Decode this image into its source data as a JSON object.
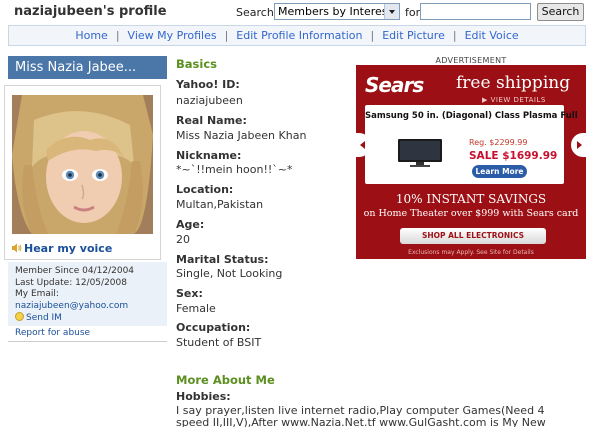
{
  "header": {
    "title": "naziajubeen's profile",
    "search_label": "Search:",
    "search_select_value": "Members by Interest",
    "for_label": "for",
    "search_input_value": "",
    "search_button": "Search"
  },
  "nav": {
    "items": [
      "Home",
      "View My Profiles",
      "Edit Profile Information",
      "Edit Picture",
      "Edit Voice"
    ],
    "separator": "|"
  },
  "sidebar": {
    "display_name": "Miss Nazia Jabee...",
    "voice_link": "Hear my voice",
    "member_since": "Member Since 04/12/2004",
    "last_update": "Last Update: 12/05/2008",
    "email_label": "My Email:",
    "email": "naziajubeen@yahoo.com",
    "send_im": "Send IM",
    "report": "Report for abuse"
  },
  "basics": {
    "title": "Basics",
    "fields": [
      {
        "label": "Yahoo! ID:",
        "value": "naziajubeen"
      },
      {
        "label": "Real Name:",
        "value": "Miss Nazia Jabeen Khan"
      },
      {
        "label": "Nickname:",
        "value": "*~`!!mein hoon!!`~*"
      },
      {
        "label": "Location:",
        "value": "Multan,Pakistan"
      },
      {
        "label": "Age:",
        "value": "20"
      },
      {
        "label": "Marital Status:",
        "value": "Single, Not Looking"
      },
      {
        "label": "Sex:",
        "value": "Female"
      },
      {
        "label": "Occupation:",
        "value": "Student of BSIT"
      }
    ]
  },
  "more": {
    "title": "More About Me",
    "hobbies_label": "Hobbies:",
    "hobbies_text": "I say prayer,listen live internet radio,Play computer Games(Need 4 speed II,III,V),After www.Nazia.Net.tf www.GulGasht.com is My New creation"
  },
  "ad": {
    "label": "ADVERTISEMENT",
    "logo": "Sears",
    "headline": "free shipping",
    "view_details": "▶ VIEW DETAILS",
    "product_title": "Samsung 50 in. (Diagonal) Class Plasma Full",
    "reg_price": "Reg. $2299.99",
    "sale_price": "SALE $1699.99",
    "learn_more": "Learn More",
    "savings": "10% INSTANT SAVINGS",
    "savings_sub": "on Home Theater over $999 with Sears card",
    "shop_button": "SHOP ALL ELECTRONICS",
    "exclusions": "Exclusions may Apply. See Site for Details",
    "colors": {
      "background": "#9c1015",
      "button": "#2a5ca8"
    }
  }
}
